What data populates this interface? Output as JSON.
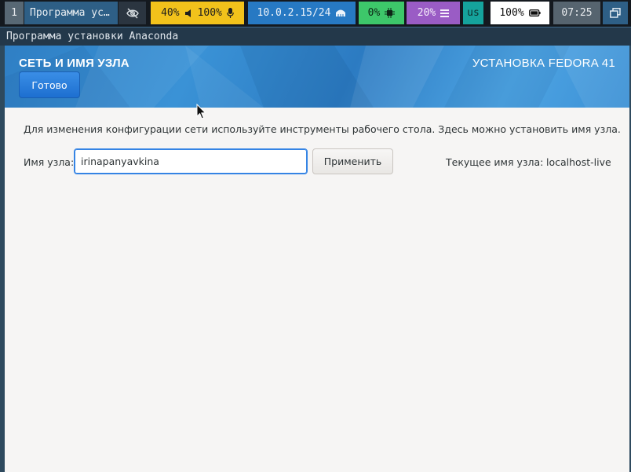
{
  "statusbar": {
    "workspace": "1",
    "window_title": "Программа ус…",
    "eye_icon": "eye-slash-icon",
    "audio": {
      "brightness": "40%",
      "volume": "100%",
      "volume_icon": "speaker-icon",
      "mic_icon": "microphone-icon"
    },
    "network": {
      "ip": "10.0.2.15/24",
      "icon": "ethernet-icon"
    },
    "cpu": {
      "value": "0%",
      "icon": "cpu-chip-icon"
    },
    "memory": {
      "value": "20%",
      "icon": "memory-bars-icon"
    },
    "keyboard": "us",
    "battery": {
      "value": "100%",
      "icon": "battery-icon"
    },
    "clock": "07:25",
    "layout_icon": "window-layout-icon",
    "colors": {
      "audio": "#f2c21b",
      "network": "#2779c3",
      "cpu": "#3dc76a",
      "memory": "#9a5cc5",
      "keyboard": "#15a39c"
    }
  },
  "window_title": "Программа установки Anaconda",
  "header": {
    "spoke_title": "СЕТЬ И ИМЯ УЗЛА",
    "product_title": "УСТАНОВКА FEDORA 41",
    "done_label": "Готово"
  },
  "content": {
    "info": "Для изменения конфигурации сети используйте инструменты рабочего стола. Здесь можно установить имя узла.",
    "hostname_label": "Имя узла:",
    "hostname_value": "irinapanyavkina",
    "apply_label": "Применить",
    "current_label": "Текущее имя узла:",
    "current_value": "localhost-live"
  }
}
